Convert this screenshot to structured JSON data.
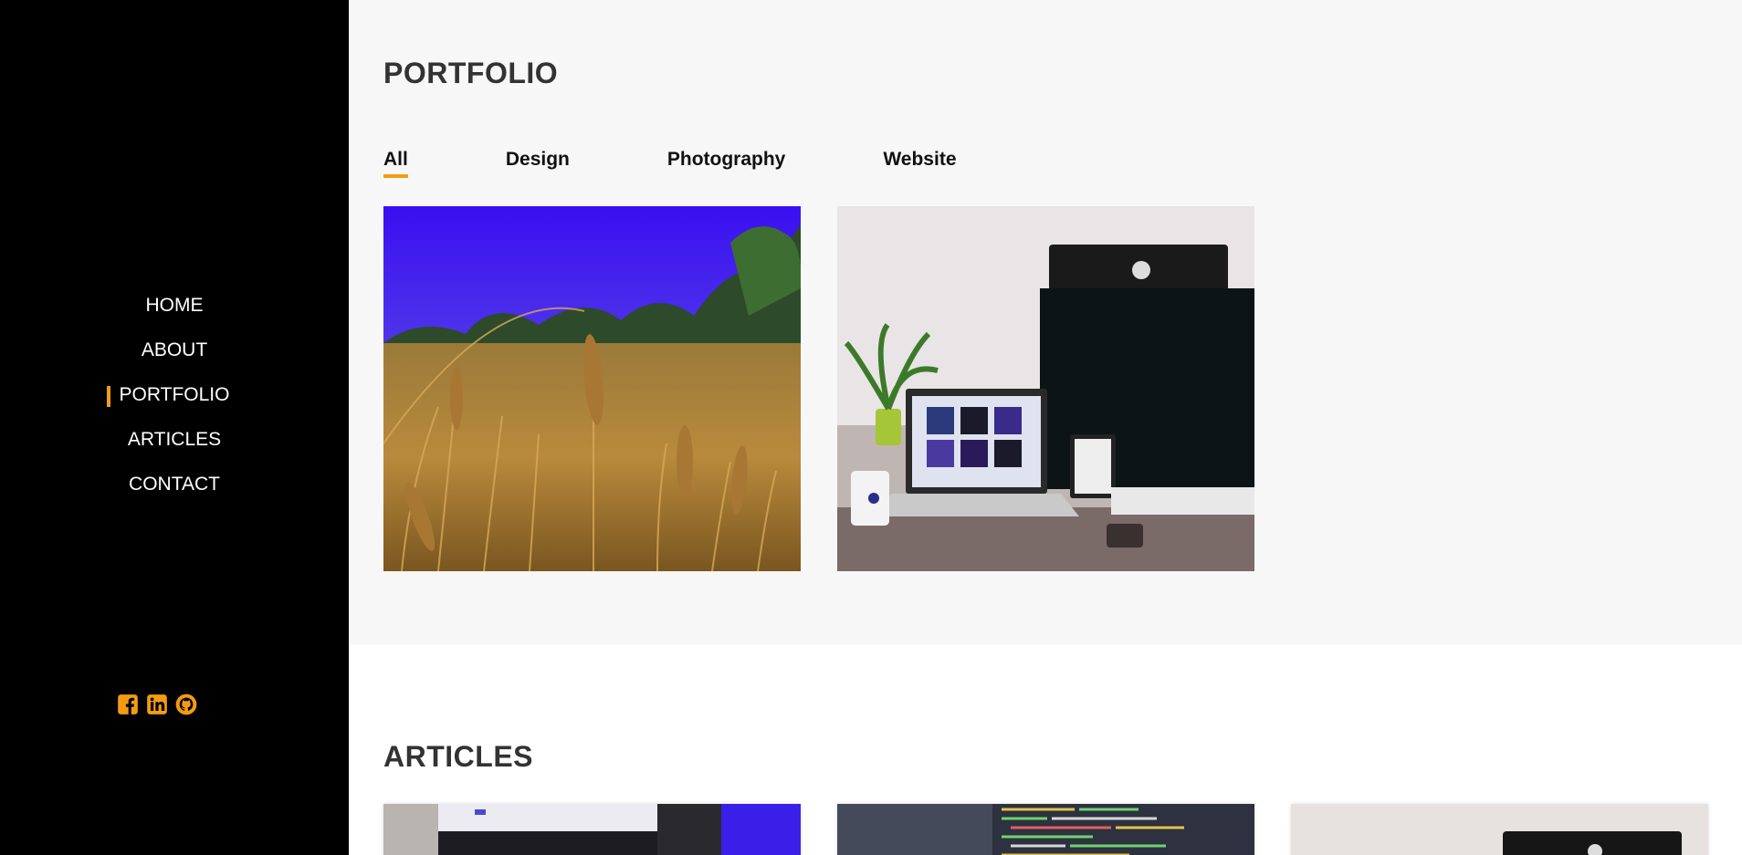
{
  "sidebar": {
    "nav": [
      {
        "label": "HOME",
        "active": false
      },
      {
        "label": "ABOUT",
        "active": false
      },
      {
        "label": "PORTFOLIO",
        "active": true
      },
      {
        "label": "ARTICLES",
        "active": false
      },
      {
        "label": "CONTACT",
        "active": false
      }
    ],
    "social_icons": [
      "facebook-icon",
      "linkedin-icon",
      "github-icon"
    ],
    "accent": "#f39c12"
  },
  "portfolio": {
    "title": "PORTFOLIO",
    "filters": [
      "All",
      "Design",
      "Photography",
      "Website"
    ],
    "active_filter": "All",
    "items": [
      {
        "image": "wheat-field-photo"
      },
      {
        "image": "desk-computer-setup-photo"
      }
    ]
  },
  "articles": {
    "title": "ARTICLES",
    "cards": [
      {
        "image": "laptop-screen-photo"
      },
      {
        "image": "code-screen-photo"
      },
      {
        "image": "monitor-desk-photo"
      }
    ]
  }
}
